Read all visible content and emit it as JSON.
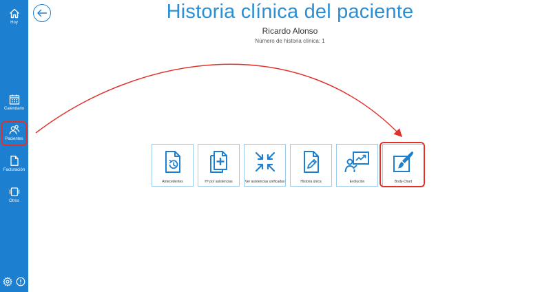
{
  "sidebar": {
    "items": [
      {
        "label": "Hoy",
        "icon": "home-icon"
      },
      {
        "label": "Calendario",
        "icon": "calendar-icon"
      },
      {
        "label": "Pacientes",
        "icon": "users-icon"
      },
      {
        "label": "Facturación",
        "icon": "document-icon"
      },
      {
        "label": "Otros",
        "icon": "device-icon"
      }
    ],
    "bottom": [
      {
        "icon": "gear-icon"
      },
      {
        "icon": "info-icon"
      }
    ]
  },
  "header": {
    "title": "Historia clínica del paciente",
    "patient_name": "Ricardo Alonso",
    "record_number": "Número de historia clínica: 1"
  },
  "tiles": [
    {
      "label": "Antecedentes",
      "icon": "history-document-icon"
    },
    {
      "label": "Hª por asistencias",
      "icon": "add-copy-icon"
    },
    {
      "label": "Ver asistencias unificadas",
      "icon": "merge-arrows-icon"
    },
    {
      "label": "Historia única",
      "icon": "edit-document-icon"
    },
    {
      "label": "Evolución",
      "icon": "presentation-icon"
    },
    {
      "label": "Body-Chart",
      "icon": "paint-brush-icon"
    }
  ],
  "colors": {
    "sidebar": "#1d7fcf",
    "accent": "#2b8fd6",
    "tile_border": "#9ccbed",
    "annotation": "#e0312b"
  }
}
